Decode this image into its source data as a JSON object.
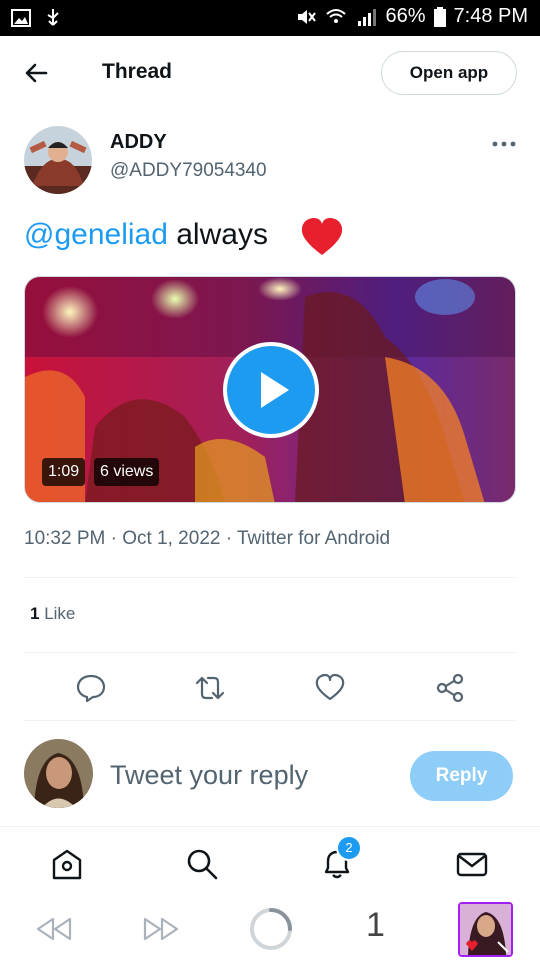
{
  "status_bar": {
    "battery": "66%",
    "time": "7:48 PM"
  },
  "header": {
    "title": "Thread",
    "open_app_label": "Open app"
  },
  "tweet": {
    "author_name": "ADDY",
    "author_handle": "@ADDY79054340",
    "mention": "@geneliad",
    "text": " always",
    "heart_emoji": "red-heart",
    "video": {
      "duration": "1:09",
      "views": "6 views"
    },
    "time": "10:32 PM",
    "date": "Oct 1, 2022",
    "source": "Twitter for Android",
    "likes_count": "1",
    "likes_label": " Like"
  },
  "reply": {
    "placeholder": "Tweet your reply",
    "button_label": "Reply"
  },
  "bottom_nav": {
    "notifications_badge": "2"
  },
  "browser": {
    "tab_count": "1"
  },
  "colors": {
    "accent": "#1d9bf0",
    "reply_disabled": "#8ecdf8",
    "secondary_text": "#536471",
    "heart": "#f91880"
  }
}
